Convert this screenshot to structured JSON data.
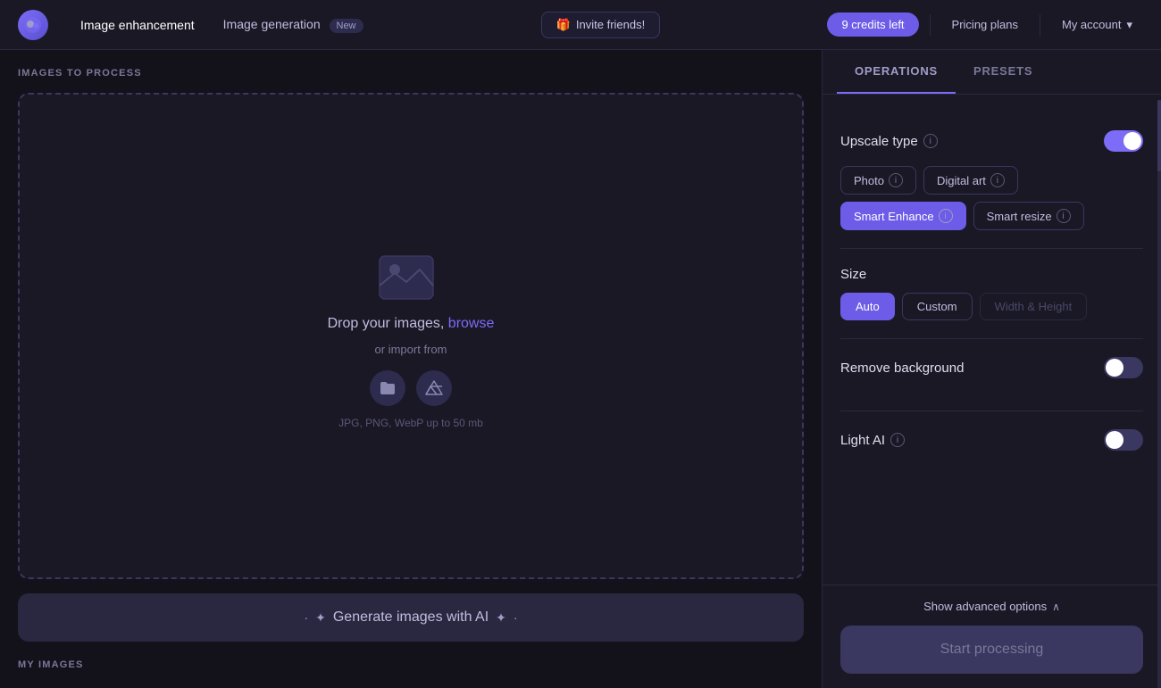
{
  "header": {
    "logo_emoji": "🟣",
    "nav_items": [
      {
        "id": "image-enhancement",
        "label": "Image enhancement",
        "active": true
      },
      {
        "id": "image-generation",
        "label": "Image generation",
        "active": false
      }
    ],
    "new_badge": "New",
    "invite_emoji": "🎁",
    "invite_label": "Invite friends!",
    "credits_label": "9 credits left",
    "pricing_label": "Pricing plans",
    "account_label": "My account"
  },
  "left_panel": {
    "images_section_label": "IMAGES TO PROCESS",
    "drop_zone": {
      "text_before_link": "Drop your images, ",
      "link_text": "browse",
      "import_label": "or import from",
      "file_types": "JPG, PNG, WebP up to 50 mb"
    },
    "generate_btn_label": "Generate images with AI",
    "my_images_label": "MY IMAGES"
  },
  "right_panel": {
    "tabs": [
      {
        "id": "operations",
        "label": "OPERATIONS",
        "active": true
      },
      {
        "id": "presets",
        "label": "PRESETS",
        "active": false
      }
    ],
    "operations": {
      "upscale_type": {
        "title": "Upscale type",
        "enabled": true,
        "options": [
          {
            "id": "photo",
            "label": "Photo",
            "active": false
          },
          {
            "id": "digital-art",
            "label": "Digital art",
            "active": false
          },
          {
            "id": "smart-enhance",
            "label": "Smart Enhance",
            "active": true
          },
          {
            "id": "smart-resize",
            "label": "Smart resize",
            "active": false
          }
        ]
      },
      "size": {
        "title": "Size",
        "options": [
          {
            "id": "auto",
            "label": "Auto",
            "active": true
          },
          {
            "id": "custom",
            "label": "Custom",
            "active": false
          },
          {
            "id": "width-height",
            "label": "Width & Height",
            "active": false,
            "disabled": true
          }
        ]
      },
      "remove_background": {
        "title": "Remove background",
        "enabled": false
      },
      "light_ai": {
        "title": "Light AI",
        "enabled": false
      }
    },
    "advanced_options_label": "Show advanced options",
    "start_processing_label": "Start processing"
  },
  "icons": {
    "chevron_down": "▾",
    "chevron_up": "∧",
    "folder": "📁",
    "drive": "▲",
    "sparkle_left": "✦",
    "sparkle_right": "✦",
    "sparkle_small_left": "·",
    "sparkle_small_right": "·",
    "info": "i",
    "image_placeholder": "🏔"
  }
}
